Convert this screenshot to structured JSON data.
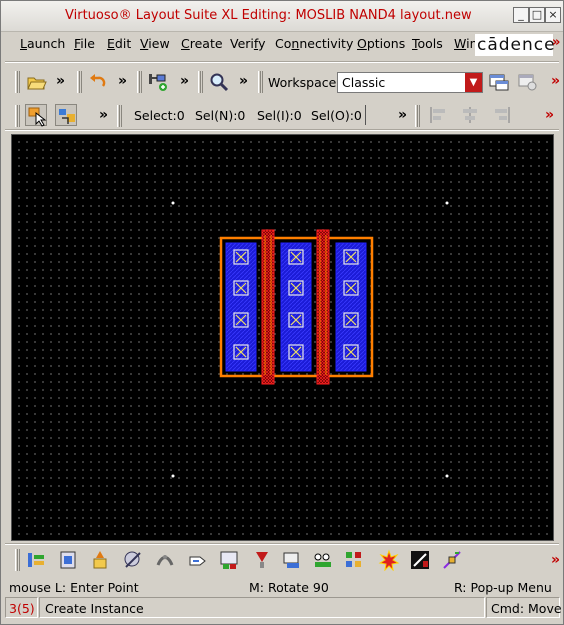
{
  "window": {
    "title": "Virtuoso® Layout Suite XL Editing: MOSLIB NAND4 layout.new",
    "controls": [
      "_",
      "□",
      "×"
    ]
  },
  "menubar": {
    "items": [
      {
        "label": "Launch",
        "u": "L",
        "rest": "aunch"
      },
      {
        "label": "File",
        "u": "F",
        "rest": "ile"
      },
      {
        "label": "Edit",
        "u": "E",
        "rest": "dit"
      },
      {
        "label": "View",
        "u": "V",
        "rest": "iew"
      },
      {
        "label": "Create",
        "u": "C",
        "rest": "reate"
      },
      {
        "label": "Verify",
        "pre": "Veri",
        "u": "f",
        "rest": "y"
      },
      {
        "label": "Connectivity",
        "pre": "Co",
        "u": "n",
        "rest": "nectivity"
      },
      {
        "label": "Options",
        "u": "O",
        "rest": "ptions"
      },
      {
        "label": "Tools",
        "u": "T",
        "rest": "ools"
      },
      {
        "label": "Win",
        "u": "W",
        "rest": "in"
      }
    ],
    "logo": "cādence"
  },
  "toolbar1": {
    "workspace_label": "Workspace:",
    "workspace_value": "Classic"
  },
  "toolbar2": {
    "select": "Select:0",
    "sel_n": "Sel(N):0",
    "sel_i": "Sel(I):0",
    "sel_o": "Sel(O):0"
  },
  "status": {
    "mouse_l": "mouse L: Enter Point",
    "mouse_m": "M: Rotate 90",
    "mouse_r": "R: Pop-up Menu",
    "count": "3(5)",
    "command": "Create Instance",
    "cmd": "Cmd: Move"
  },
  "colors": {
    "title_text": "#c00000",
    "oxide": "#ff7f00",
    "poly": "#ff2020",
    "metal": "#1b1bd6",
    "contact": "#e8e8e8"
  },
  "icons": {
    "open": "folder-open-icon",
    "undo": "undo-icon",
    "create_pin": "create-pin-icon",
    "zoom": "magnifier-icon",
    "workspace_save": "workspace-save-icon",
    "workspace_load": "workspace-load-icon",
    "select_mode": "select-pointer-icon",
    "select_filter": "select-filter-icon",
    "align_left": "align-left-icon",
    "align_center": "align-center-icon",
    "align_right": "align-right-icon"
  }
}
